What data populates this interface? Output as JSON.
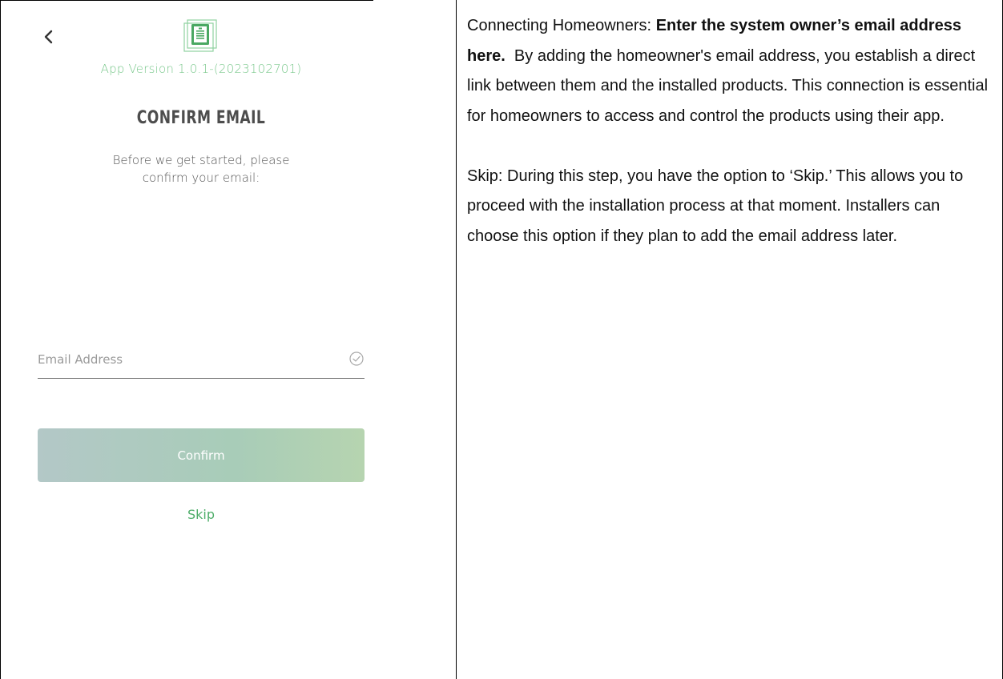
{
  "app": {
    "version": "App Version 1.0.1-(2023102701)",
    "title": "CONFIRM EMAIL",
    "subtitle": "Before we get started, please confirm your email:",
    "email": {
      "placeholder": "Email Address",
      "value": ""
    },
    "confirm_label": "Confirm",
    "skip_label": "Skip",
    "icons": {
      "back": "chevron-left-icon",
      "logo": "battery-document-logo",
      "check": "check-circle-icon"
    },
    "colors": {
      "accent_green": "#4fae6a",
      "version_green": "#7cc98e",
      "button_gradient_start": "#b3c8c7",
      "button_gradient_end": "#b6d4b0"
    }
  },
  "description": {
    "para1": {
      "label": "Connecting Homeowners: ",
      "bold": "Enter the system owner’s email address here.",
      "text": "  By adding the homeowner's email address, you establish a direct link between them and the installed products. This connection is essential for homeowners to access and control the products using their app."
    },
    "para2": {
      "text": "Skip: During this step, you have the option to ‘Skip.’ This allows you to proceed with the installation process at that moment. Installers can choose this option if they plan to add the email address later."
    }
  }
}
